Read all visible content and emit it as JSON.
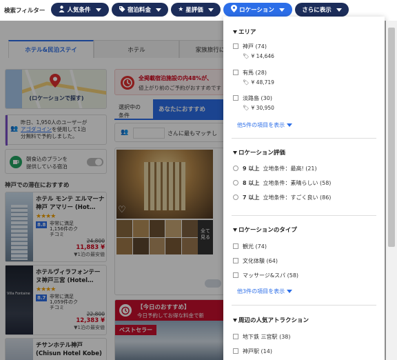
{
  "filter_bar": {
    "label": "検索フィルター",
    "pills": [
      {
        "label": "人気条件",
        "icon": "person-icon"
      },
      {
        "label": "宿泊料金",
        "icon": "tag-icon"
      },
      {
        "label": "星評価",
        "icon": "star-icon"
      },
      {
        "label": "ロケーション",
        "icon": "map-pin-icon",
        "active": true
      },
      {
        "label": "さらに表示",
        "icon": ""
      }
    ]
  },
  "tabs": [
    "ホテル&民泊ステイ",
    "ホテル",
    "家族旅行に"
  ],
  "map": {
    "label": "(ロケーションで探す)"
  },
  "banner": {
    "text": "全掲載宿泊施設の内48%が、",
    "subtext": "値上がり前のご予約がおすすめです"
  },
  "sort_tabs": {
    "selected_label_1": "選択中の",
    "selected_label_2": "条件",
    "recommended": "あなたにおすすめ"
  },
  "user_message": {
    "text": "さんに最もマッチし"
  },
  "notice": {
    "line1": "昨日、1,950人のユーザーが",
    "line2_prefix": "",
    "link": "アゴダコイン",
    "line2_suffix": "を使用して1泊",
    "line3": "分無料で予約しました。"
  },
  "toggle_card": {
    "line1": "朝食込のプランを",
    "line2": "提供している宿泊"
  },
  "section_title": "神戸での滞在におすすめ",
  "hotels": [
    {
      "name": "ホテル モンテ エルマーナ神戸 アマリー (Hot…",
      "stars": "★★★★",
      "score": "8.8",
      "review_1": "非常に満足",
      "review_2": "1,156件のク",
      "review_3": "チコミ",
      "original_price": "24,800",
      "price": "11,883 ¥",
      "note": "1泊の最安値"
    },
    {
      "name": "ホテルヴィラフォンテーヌ神戸三宮 (Hotel…",
      "stars": "★★★★",
      "score": "8.7",
      "review_1": "非常に満足",
      "review_2": "1,059件のク",
      "review_3": "チコミ",
      "original_price": "22,800",
      "price": "12,383 ¥",
      "note": "1泊の最安値"
    },
    {
      "name": "チサンホテル神戸",
      "name_en": "(Chisun Hotel Kobe)"
    }
  ],
  "photo_card": {
    "heart_icon": "heart-icon",
    "all_label_1": "全て",
    "all_label_2": "見る"
  },
  "promo": {
    "title": "【今日のおすすめ】",
    "text": "今日予約してお得な料金で新",
    "badge": "ベストセラー"
  },
  "location_panel": {
    "area": {
      "title": "エリア",
      "items": [
        {
          "label": "神戸 (74)",
          "price": "¥ 14,646"
        },
        {
          "label": "有馬 (28)",
          "price": "¥ 48,719"
        },
        {
          "label": "淡路島 (30)",
          "price": "¥ 30,950"
        }
      ],
      "more": "他5件の項目を表示"
    },
    "rating": {
      "title": "ロケーション評価",
      "items": [
        {
          "score": "9 以上",
          "label": "立地条件：最高! (21)"
        },
        {
          "score": "8 以上",
          "label": "立地条件：素晴らしい (58)"
        },
        {
          "score": "7 以上",
          "label": "立地条件：すごく良い (86)"
        }
      ]
    },
    "type": {
      "title": "ロケーションのタイプ",
      "items": [
        "観光 (74)",
        "文化体験 (64)",
        "マッサージ&スパ (58)"
      ],
      "more": "他3件の項目を表示"
    },
    "attraction": {
      "title": "周辺の人気アトラクション",
      "items": [
        "地下鉄 三宮駅 (38)",
        "神戸駅 (14)"
      ]
    }
  },
  "colors": {
    "navy": "#1c2d5a",
    "accent_blue": "#2c6ee8",
    "price_red": "#d0021b",
    "badge_red": "#c8102e"
  }
}
